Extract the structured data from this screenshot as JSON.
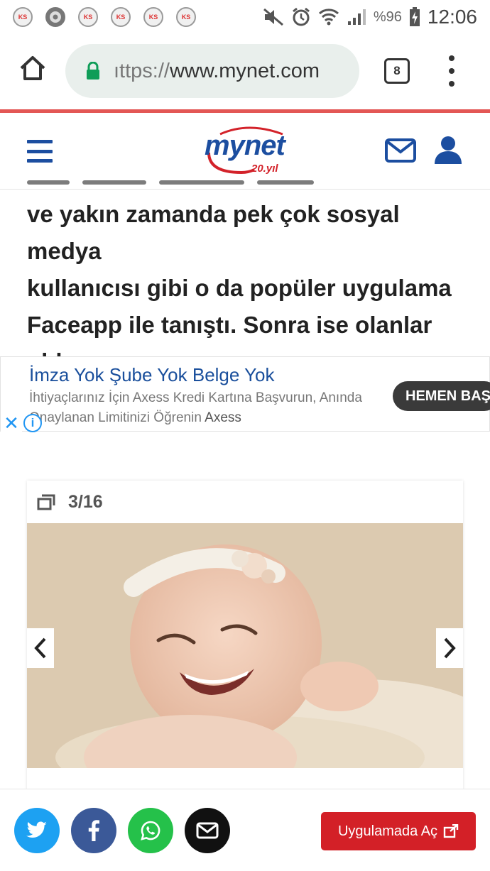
{
  "status_bar": {
    "battery": "%96",
    "time": "12:06"
  },
  "browser": {
    "url_scheme": "ıttps://",
    "url_host": "www.mynet.com",
    "tab_count": "8"
  },
  "site": {
    "logo_text": "mynet",
    "logo_sub": "20.yıl",
    "brand_color": "#1c4ea0",
    "accent_color": "#d3222a"
  },
  "article": {
    "lines": [
      "ve yakın zamanda pek çok sosyal medya",
      "kullanıcısı gibi o da popüler uygulama",
      "Faceapp ile tanıştı. Sonra ise olanlar",
      "oldu."
    ]
  },
  "ad": {
    "title": "İmza Yok Şube Yok Belge Yok",
    "description": "İhtiyaçlarınız İçin Axess Kredi Kartına Başvurun, Anında Onaylanan Limitinizi Öğrenin",
    "brand": "Axess",
    "cta": "HEMEN BAŞVUR",
    "close": "✕",
    "info": "i"
  },
  "gallery": {
    "counter": "3/16",
    "prev": "‹",
    "next": "›"
  },
  "bottom_bar": {
    "share_icons": [
      "twitter-icon",
      "facebook-icon",
      "whatsapp-icon",
      "mail-icon"
    ],
    "open_app_label": "Uygulamada Aç",
    "open_app_color": "#d32027"
  }
}
